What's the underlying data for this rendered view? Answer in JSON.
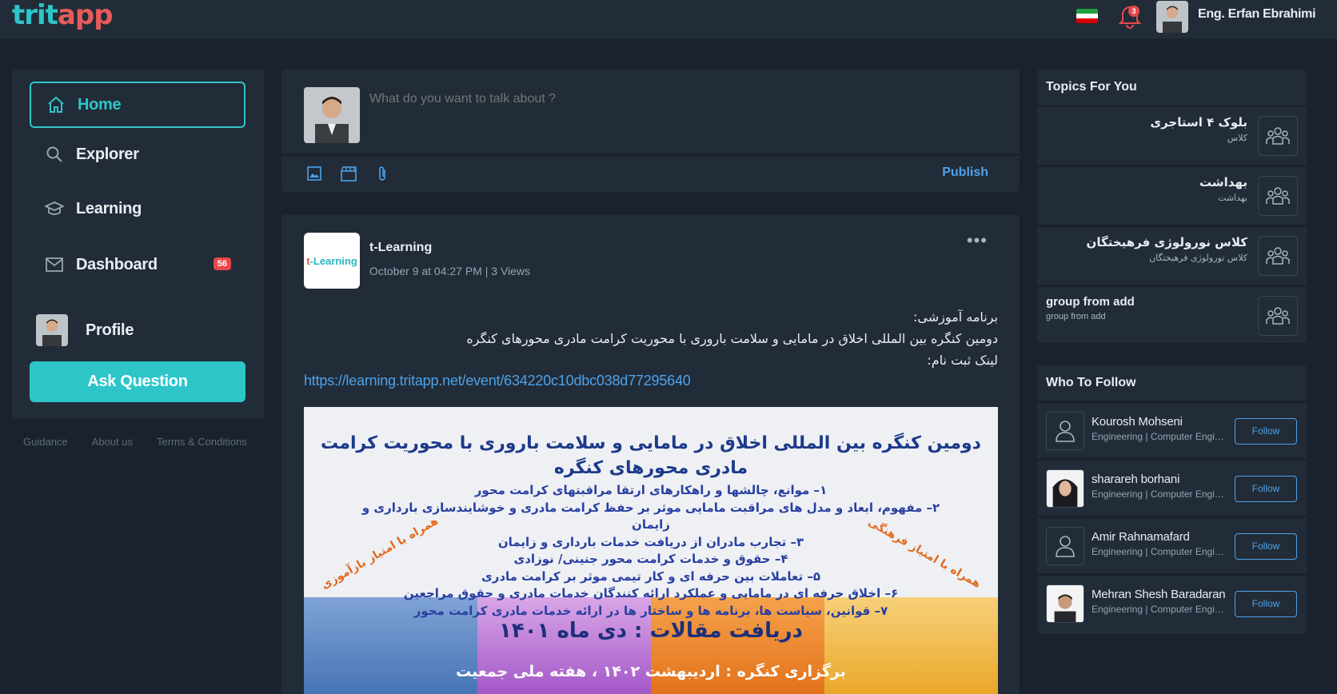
{
  "header": {
    "logo_part1": "trit",
    "logo_part2": "app",
    "notification_count": "3",
    "user_name": "Eng. Erfan Ebrahimi"
  },
  "sidebar": {
    "items": [
      {
        "label": "Home",
        "icon": "home-icon"
      },
      {
        "label": "Explorer",
        "icon": "search-icon"
      },
      {
        "label": "Learning",
        "icon": "graduation-cap-icon"
      },
      {
        "label": "Dashboard",
        "icon": "mail-icon",
        "badge": "56"
      },
      {
        "label": "Profile",
        "icon": "avatar"
      }
    ],
    "ask_button": "Ask Question",
    "footer": [
      "Guidance",
      "About us",
      "Terms & Conditions"
    ]
  },
  "composer": {
    "placeholder": "What do you want to talk about ?",
    "publish": "Publish"
  },
  "post": {
    "author": "t-Learning",
    "logo_text_1": "t",
    "logo_text_2": "-Learning",
    "meta": "October 9 at 04:27 PM | 3 Views",
    "body_line1": "برنامه آموزشی:",
    "body_line2": "دومین کنگره بین المللی اخلاق در مامایی و سلامت باروری با محوریت کرامت مادری محورهای کنگره",
    "body_line3": "لینک ثبت نام:",
    "link": "https://learning.tritapp.net/event/634220c10dbc038d77295640",
    "image": {
      "title": "دومین کنگره بین المللی اخلاق در مامایی و سلامت باروری با محوریت کرامت مادری محورهای کنگره",
      "lines": [
        "۱– موانع، چالشها و راهکارهای ارتقا مراقبتهای کرامت محور",
        "۲– مفهوم، ابعاد و مدل های مراقبت مامایی موثر بر حفظ کرامت مادری و خوشایندسازی بارداری و زایمان",
        "۳– تجارب مادران از دریافت خدمات بارداری و زایمان",
        "۴– حقوق و خدمات کرامت محور جنینی/ نوزادی",
        "۵– تعاملات بین حرفه ای و کار تیمی موثر بر کرامت مادری",
        "۶– اخلاق حرفه ای در مامایی و عملکرد ارائه کنندگان خدمات مادری و حقوق مراجعین",
        "۷– قوانین، سیاست ها، برنامه ها و ساختار ها در ارائه خدمات مادری کرامت محور"
      ],
      "left_stamp": "همراه با امتیاز بازآموزی",
      "right_stamp": "همراه با امتیاز فرهنگی",
      "deadline": "دریافت مقالات : دی ماه ۱۴۰۱",
      "held": "برگزاری کنگره : اردیبهشت ۱۴۰۲ ، هفته ملی جمعیت"
    }
  },
  "topics": {
    "title": "Topics For You",
    "items": [
      {
        "name": "بلوک ۴ استاجری",
        "sub": "کلاس"
      },
      {
        "name": "بهداشت",
        "sub": "بهداشت"
      },
      {
        "name": "کلاس نورولوژی فرهیختگان",
        "sub": "کلاس نورولوژی فرهیختگان"
      },
      {
        "name": "group from add",
        "sub": "group from add"
      }
    ]
  },
  "who_to_follow": {
    "title": "Who To Follow",
    "follow_label": "Follow",
    "people": [
      {
        "name": "Kourosh Mohseni",
        "sub": "Engineering | Computer Engineering"
      },
      {
        "name": "sharareh borhani",
        "sub": "Engineering | Computer Engineering"
      },
      {
        "name": "Amir Rahnamafard",
        "sub": "Engineering | Computer Engineering"
      },
      {
        "name": "Mehran Shesh Baradaran",
        "sub": "Engineering | Computer Engineering"
      }
    ]
  },
  "colors": {
    "accent": "#2ec5c9",
    "link": "#4ea2ea",
    "badge": "#e8484b",
    "bg": "#19222d",
    "panel": "#212c38"
  }
}
